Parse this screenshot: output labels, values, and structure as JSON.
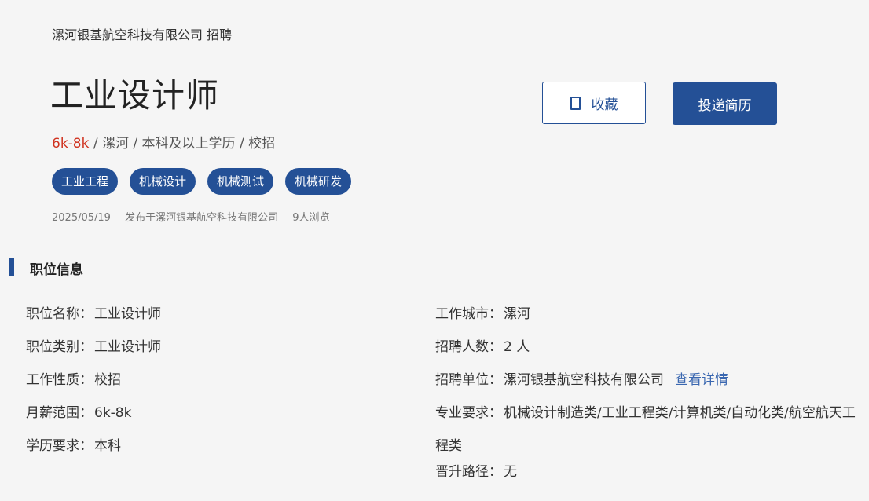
{
  "header": {
    "company_line": "漯河银基航空科技有限公司 招聘",
    "job_title": "工业设计师",
    "salary": "6k-8k",
    "summary_rest": " / 漯河 / 本科及以上学历 / 校招",
    "tags": [
      "工业工程",
      "机械设计",
      "机械测试",
      "机械研发"
    ],
    "meta": {
      "date": "2025/05/19",
      "publisher": "发布于漯河银基航空科技有限公司",
      "views": "9人浏览"
    }
  },
  "actions": {
    "favorite_label": "收藏",
    "apply_label": "投递简历"
  },
  "section": {
    "title": "职位信息"
  },
  "info_left": [
    {
      "label": "职位名称：",
      "value": "工业设计师"
    },
    {
      "label": "职位类别：",
      "value": "工业设计师"
    },
    {
      "label": "工作性质：",
      "value": "校招"
    },
    {
      "label": "月薪范围：",
      "value": "6k-8k"
    },
    {
      "label": "学历要求：",
      "value": "本科"
    }
  ],
  "info_right": [
    {
      "label": "工作城市：",
      "value": "漯河"
    },
    {
      "label": "招聘人数：",
      "value": "2 人"
    },
    {
      "label": "招聘单位：",
      "value": "漯河银基航空科技有限公司",
      "link": "查看详情"
    },
    {
      "label": "专业要求：",
      "value": "机械设计制造类/工业工程类/计算机类/自动化类/航空航天工程类"
    },
    {
      "label": "晋升路径：",
      "value": "无"
    }
  ]
}
